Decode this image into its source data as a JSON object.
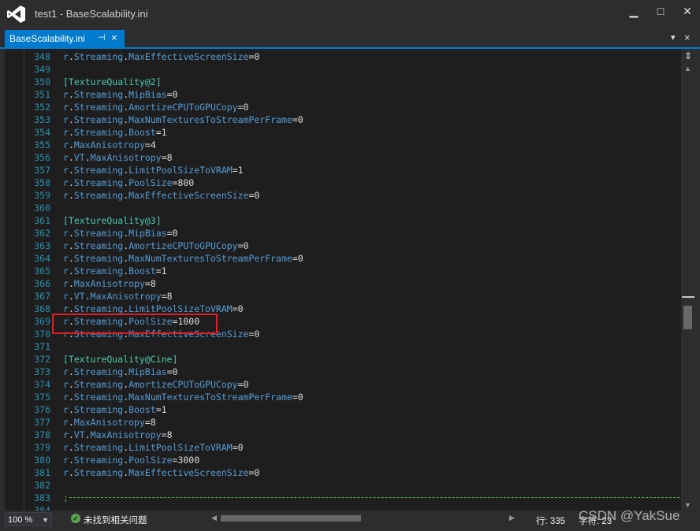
{
  "window": {
    "title": "test1 - BaseScalability.ini",
    "minimize": "▁",
    "maximize": "□",
    "close": "✕"
  },
  "tab": {
    "label": "BaseScalability.ini",
    "pin": "⊣",
    "close": "×",
    "dropdown": "▾",
    "close_doc": "×"
  },
  "editor": {
    "lines": [
      {
        "n": "348",
        "parts": [
          {
            "t": "r",
            "c": "key"
          },
          {
            "t": ".",
            "c": "dot"
          },
          {
            "t": "Streaming",
            "c": "key"
          },
          {
            "t": ".",
            "c": "dot"
          },
          {
            "t": "MaxEffectiveScreenSize",
            "c": "key"
          },
          {
            "t": "=0",
            "c": "val"
          }
        ]
      },
      {
        "n": "349",
        "parts": []
      },
      {
        "n": "350",
        "parts": [
          {
            "t": "[TextureQuality@2]",
            "c": "sec"
          }
        ]
      },
      {
        "n": "351",
        "parts": [
          {
            "t": "r",
            "c": "key"
          },
          {
            "t": ".",
            "c": "dot"
          },
          {
            "t": "Streaming",
            "c": "key"
          },
          {
            "t": ".",
            "c": "dot"
          },
          {
            "t": "MipBias",
            "c": "key"
          },
          {
            "t": "=0",
            "c": "val"
          }
        ]
      },
      {
        "n": "352",
        "parts": [
          {
            "t": "r",
            "c": "key"
          },
          {
            "t": ".",
            "c": "dot"
          },
          {
            "t": "Streaming",
            "c": "key"
          },
          {
            "t": ".",
            "c": "dot"
          },
          {
            "t": "AmortizeCPUToGPUCopy",
            "c": "key"
          },
          {
            "t": "=0",
            "c": "val"
          }
        ]
      },
      {
        "n": "353",
        "parts": [
          {
            "t": "r",
            "c": "key"
          },
          {
            "t": ".",
            "c": "dot"
          },
          {
            "t": "Streaming",
            "c": "key"
          },
          {
            "t": ".",
            "c": "dot"
          },
          {
            "t": "MaxNumTexturesToStreamPerFrame",
            "c": "key"
          },
          {
            "t": "=0",
            "c": "val"
          }
        ]
      },
      {
        "n": "354",
        "parts": [
          {
            "t": "r",
            "c": "key"
          },
          {
            "t": ".",
            "c": "dot"
          },
          {
            "t": "Streaming",
            "c": "key"
          },
          {
            "t": ".",
            "c": "dot"
          },
          {
            "t": "Boost",
            "c": "key"
          },
          {
            "t": "=1",
            "c": "val"
          }
        ]
      },
      {
        "n": "355",
        "parts": [
          {
            "t": "r",
            "c": "key"
          },
          {
            "t": ".",
            "c": "dot"
          },
          {
            "t": "MaxAnisotropy",
            "c": "key"
          },
          {
            "t": "=4",
            "c": "val"
          }
        ]
      },
      {
        "n": "356",
        "parts": [
          {
            "t": "r",
            "c": "key"
          },
          {
            "t": ".",
            "c": "dot"
          },
          {
            "t": "VT",
            "c": "key"
          },
          {
            "t": ".",
            "c": "dot"
          },
          {
            "t": "MaxAnisotropy",
            "c": "key"
          },
          {
            "t": "=8",
            "c": "val"
          }
        ]
      },
      {
        "n": "357",
        "parts": [
          {
            "t": "r",
            "c": "key"
          },
          {
            "t": ".",
            "c": "dot"
          },
          {
            "t": "Streaming",
            "c": "key"
          },
          {
            "t": ".",
            "c": "dot"
          },
          {
            "t": "LimitPoolSizeToVRAM",
            "c": "key"
          },
          {
            "t": "=1",
            "c": "val"
          }
        ]
      },
      {
        "n": "358",
        "parts": [
          {
            "t": "r",
            "c": "key"
          },
          {
            "t": ".",
            "c": "dot"
          },
          {
            "t": "Streaming",
            "c": "key"
          },
          {
            "t": ".",
            "c": "dot"
          },
          {
            "t": "PoolSize",
            "c": "key"
          },
          {
            "t": "=800",
            "c": "val"
          }
        ]
      },
      {
        "n": "359",
        "parts": [
          {
            "t": "r",
            "c": "key"
          },
          {
            "t": ".",
            "c": "dot"
          },
          {
            "t": "Streaming",
            "c": "key"
          },
          {
            "t": ".",
            "c": "dot"
          },
          {
            "t": "MaxEffectiveScreenSize",
            "c": "key"
          },
          {
            "t": "=0",
            "c": "val"
          }
        ]
      },
      {
        "n": "360",
        "parts": []
      },
      {
        "n": "361",
        "parts": [
          {
            "t": "[TextureQuality@3]",
            "c": "sec"
          }
        ]
      },
      {
        "n": "362",
        "parts": [
          {
            "t": "r",
            "c": "key"
          },
          {
            "t": ".",
            "c": "dot"
          },
          {
            "t": "Streaming",
            "c": "key"
          },
          {
            "t": ".",
            "c": "dot"
          },
          {
            "t": "MipBias",
            "c": "key"
          },
          {
            "t": "=0",
            "c": "val"
          }
        ]
      },
      {
        "n": "363",
        "parts": [
          {
            "t": "r",
            "c": "key"
          },
          {
            "t": ".",
            "c": "dot"
          },
          {
            "t": "Streaming",
            "c": "key"
          },
          {
            "t": ".",
            "c": "dot"
          },
          {
            "t": "AmortizeCPUToGPUCopy",
            "c": "key"
          },
          {
            "t": "=0",
            "c": "val"
          }
        ]
      },
      {
        "n": "364",
        "parts": [
          {
            "t": "r",
            "c": "key"
          },
          {
            "t": ".",
            "c": "dot"
          },
          {
            "t": "Streaming",
            "c": "key"
          },
          {
            "t": ".",
            "c": "dot"
          },
          {
            "t": "MaxNumTexturesToStreamPerFrame",
            "c": "key"
          },
          {
            "t": "=0",
            "c": "val"
          }
        ]
      },
      {
        "n": "365",
        "parts": [
          {
            "t": "r",
            "c": "key"
          },
          {
            "t": ".",
            "c": "dot"
          },
          {
            "t": "Streaming",
            "c": "key"
          },
          {
            "t": ".",
            "c": "dot"
          },
          {
            "t": "Boost",
            "c": "key"
          },
          {
            "t": "=1",
            "c": "val"
          }
        ]
      },
      {
        "n": "366",
        "parts": [
          {
            "t": "r",
            "c": "key"
          },
          {
            "t": ".",
            "c": "dot"
          },
          {
            "t": "MaxAnisotropy",
            "c": "key"
          },
          {
            "t": "=8",
            "c": "val"
          }
        ]
      },
      {
        "n": "367",
        "parts": [
          {
            "t": "r",
            "c": "key"
          },
          {
            "t": ".",
            "c": "dot"
          },
          {
            "t": "VT",
            "c": "key"
          },
          {
            "t": ".",
            "c": "dot"
          },
          {
            "t": "MaxAnisotropy",
            "c": "key"
          },
          {
            "t": "=8",
            "c": "val"
          }
        ]
      },
      {
        "n": "368",
        "parts": [
          {
            "t": "r",
            "c": "key"
          },
          {
            "t": ".",
            "c": "dot"
          },
          {
            "t": "Streaming",
            "c": "key"
          },
          {
            "t": ".",
            "c": "dot"
          },
          {
            "t": "LimitPoolSizeToVRAM",
            "c": "key"
          },
          {
            "t": "=0",
            "c": "val"
          }
        ]
      },
      {
        "n": "369",
        "parts": [
          {
            "t": "r",
            "c": "key"
          },
          {
            "t": ".",
            "c": "dot"
          },
          {
            "t": "Streaming",
            "c": "key"
          },
          {
            "t": ".",
            "c": "dot"
          },
          {
            "t": "PoolSize",
            "c": "key"
          },
          {
            "t": "=1000",
            "c": "val"
          }
        ]
      },
      {
        "n": "370",
        "parts": [
          {
            "t": "r",
            "c": "key"
          },
          {
            "t": ".",
            "c": "dot"
          },
          {
            "t": "Streaming",
            "c": "key"
          },
          {
            "t": ".",
            "c": "dot"
          },
          {
            "t": "MaxEffectiveScreenSize",
            "c": "key"
          },
          {
            "t": "=0",
            "c": "val"
          }
        ]
      },
      {
        "n": "371",
        "parts": []
      },
      {
        "n": "372",
        "parts": [
          {
            "t": "[TextureQuality@Cine]",
            "c": "sec"
          }
        ]
      },
      {
        "n": "373",
        "parts": [
          {
            "t": "r",
            "c": "key"
          },
          {
            "t": ".",
            "c": "dot"
          },
          {
            "t": "Streaming",
            "c": "key"
          },
          {
            "t": ".",
            "c": "dot"
          },
          {
            "t": "MipBias",
            "c": "key"
          },
          {
            "t": "=0",
            "c": "val"
          }
        ]
      },
      {
        "n": "374",
        "parts": [
          {
            "t": "r",
            "c": "key"
          },
          {
            "t": ".",
            "c": "dot"
          },
          {
            "t": "Streaming",
            "c": "key"
          },
          {
            "t": ".",
            "c": "dot"
          },
          {
            "t": "AmortizeCPUToGPUCopy",
            "c": "key"
          },
          {
            "t": "=0",
            "c": "val"
          }
        ]
      },
      {
        "n": "375",
        "parts": [
          {
            "t": "r",
            "c": "key"
          },
          {
            "t": ".",
            "c": "dot"
          },
          {
            "t": "Streaming",
            "c": "key"
          },
          {
            "t": ".",
            "c": "dot"
          },
          {
            "t": "MaxNumTexturesToStreamPerFrame",
            "c": "key"
          },
          {
            "t": "=0",
            "c": "val"
          }
        ]
      },
      {
        "n": "376",
        "parts": [
          {
            "t": "r",
            "c": "key"
          },
          {
            "t": ".",
            "c": "dot"
          },
          {
            "t": "Streaming",
            "c": "key"
          },
          {
            "t": ".",
            "c": "dot"
          },
          {
            "t": "Boost",
            "c": "key"
          },
          {
            "t": "=1",
            "c": "val"
          }
        ]
      },
      {
        "n": "377",
        "parts": [
          {
            "t": "r",
            "c": "key"
          },
          {
            "t": ".",
            "c": "dot"
          },
          {
            "t": "MaxAnisotropy",
            "c": "key"
          },
          {
            "t": "=8",
            "c": "val"
          }
        ]
      },
      {
        "n": "378",
        "parts": [
          {
            "t": "r",
            "c": "key"
          },
          {
            "t": ".",
            "c": "dot"
          },
          {
            "t": "VT",
            "c": "key"
          },
          {
            "t": ".",
            "c": "dot"
          },
          {
            "t": "MaxAnisotropy",
            "c": "key"
          },
          {
            "t": "=8",
            "c": "val"
          }
        ]
      },
      {
        "n": "379",
        "parts": [
          {
            "t": "r",
            "c": "key"
          },
          {
            "t": ".",
            "c": "dot"
          },
          {
            "t": "Streaming",
            "c": "key"
          },
          {
            "t": ".",
            "c": "dot"
          },
          {
            "t": "LimitPoolSizeToVRAM",
            "c": "key"
          },
          {
            "t": "=0",
            "c": "val"
          }
        ]
      },
      {
        "n": "380",
        "parts": [
          {
            "t": "r",
            "c": "key"
          },
          {
            "t": ".",
            "c": "dot"
          },
          {
            "t": "Streaming",
            "c": "key"
          },
          {
            "t": ".",
            "c": "dot"
          },
          {
            "t": "PoolSize",
            "c": "key"
          },
          {
            "t": "=3000",
            "c": "val"
          }
        ]
      },
      {
        "n": "381",
        "parts": [
          {
            "t": "r",
            "c": "key"
          },
          {
            "t": ".",
            "c": "dot"
          },
          {
            "t": "Streaming",
            "c": "key"
          },
          {
            "t": ".",
            "c": "dot"
          },
          {
            "t": "MaxEffectiveScreenSize",
            "c": "key"
          },
          {
            "t": "=0",
            "c": "val"
          }
        ]
      },
      {
        "n": "382",
        "parts": []
      },
      {
        "n": "383",
        "parts": [
          {
            "t": ";",
            "c": "sepchar"
          }
        ],
        "separator": true
      },
      {
        "n": "384",
        "parts": []
      }
    ],
    "highlighted_line": "369"
  },
  "status": {
    "zoom": "100 %",
    "issues": "未找到相关问题",
    "line": "行: 335",
    "char": "字符: 23"
  },
  "watermark": "CSDN @YakSue",
  "colors": {
    "accent": "#007acc",
    "line_number": "#2b91af",
    "key": "#569cd6",
    "value": "#dcdcdc",
    "section": "#4ec9b0",
    "highlight_border": "#e51c23",
    "separator": "#57a64a"
  }
}
